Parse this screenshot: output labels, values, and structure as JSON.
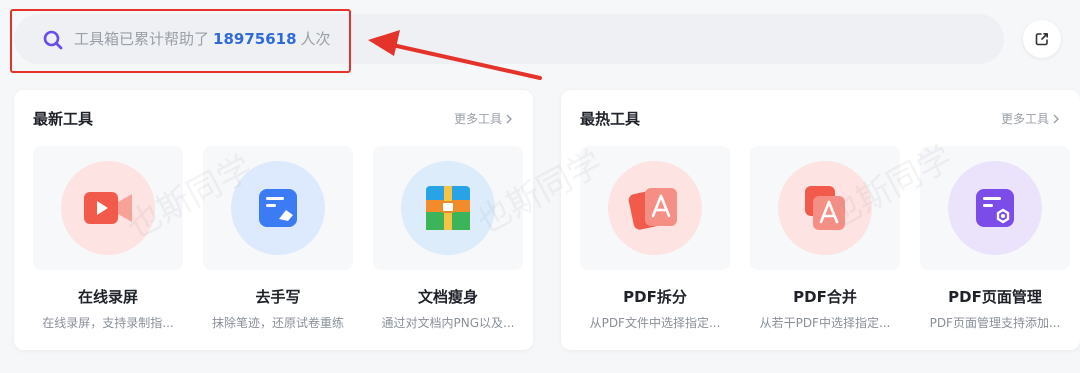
{
  "search": {
    "prefix": "工具箱已累计帮助了",
    "count": "18975618",
    "suffix": "人次"
  },
  "latest": {
    "title": "最新工具",
    "more": "更多工具",
    "tools": [
      {
        "name": "在线录屏",
        "desc": "在线录屏，支持录制指..."
      },
      {
        "name": "去手写",
        "desc": "抹除笔迹，还原试卷重练"
      },
      {
        "name": "文档瘦身",
        "desc": "通过对文档内PNG以及..."
      }
    ]
  },
  "hot": {
    "title": "最热工具",
    "more": "更多工具",
    "tools": [
      {
        "name": "PDF拆分",
        "desc": "从PDF文件中选择指定..."
      },
      {
        "name": "PDF合并",
        "desc": "从若干PDF中选择指定..."
      },
      {
        "name": "PDF页面管理",
        "desc": "PDF页面管理支持添加..."
      }
    ]
  },
  "watermark": "也斯同学",
  "colors": {
    "accent": "#2f6bd8",
    "highlight": "#e4332a",
    "search_icon": "#6a4de8"
  },
  "icons": {
    "search": "search-icon",
    "share": "share-icon",
    "more": "chevron-right-icon"
  }
}
